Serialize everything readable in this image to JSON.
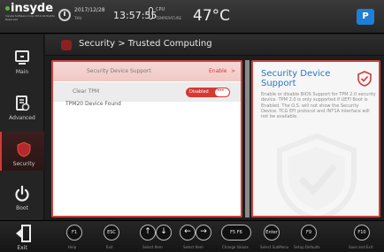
{
  "header": {
    "brand": "insyde",
    "brand_subtext": "Insyde Software Corp 2019 All Rights Reserved",
    "date": "2017/12/28",
    "day": "THU",
    "time": "13:57:55",
    "cpu_label": "CPU",
    "temperature_label": "TEMPERATURE",
    "temperature": "47°C",
    "corner_logo": "P"
  },
  "sidebar": {
    "items": [
      {
        "label": "Main",
        "icon": "monitor-icon"
      },
      {
        "label": "Advanced",
        "icon": "document-gear-icon"
      },
      {
        "label": "Security",
        "icon": "shield-icon",
        "active": true
      },
      {
        "label": "Boot",
        "icon": "power-icon"
      }
    ]
  },
  "page": {
    "breadcrumb": "Security > Trusted Computing"
  },
  "settings": {
    "security_device_support": {
      "label": "Security Device Support",
      "value": "Enable",
      "arrow": ">"
    },
    "clear_tpm": {
      "label": "Clear TPM",
      "value": "Disabled"
    },
    "tpm_status": "TPM20 Device Found"
  },
  "help": {
    "title": "Security Device Support",
    "text": "Enable or disable BIOS Support for TPM 2.0 security device. TPM 2.0 is only supported if UEFI Boot is Enabled. The O.S. will not show the Security Device. TCG EFI protocol and INT1A interface will not be available."
  },
  "footer": {
    "exit_label": "Exit",
    "keys": [
      {
        "key": "F1",
        "label": "Help"
      },
      {
        "key": "ESC",
        "label": "Exit"
      },
      {
        "key": "↑↓",
        "label": "Select Item"
      },
      {
        "key": "←→",
        "label": "Select Item"
      },
      {
        "key": "F5 F6",
        "label": "Change Values"
      },
      {
        "key": "Enter",
        "label": "Select SubMenu"
      },
      {
        "key": "F9",
        "label": "Setup Defaults"
      },
      {
        "key": "F10",
        "label": "Save and Exit"
      }
    ]
  },
  "colors": {
    "accent": "#c9433c",
    "help_title": "#2876c7",
    "toggle": "#d73832"
  }
}
